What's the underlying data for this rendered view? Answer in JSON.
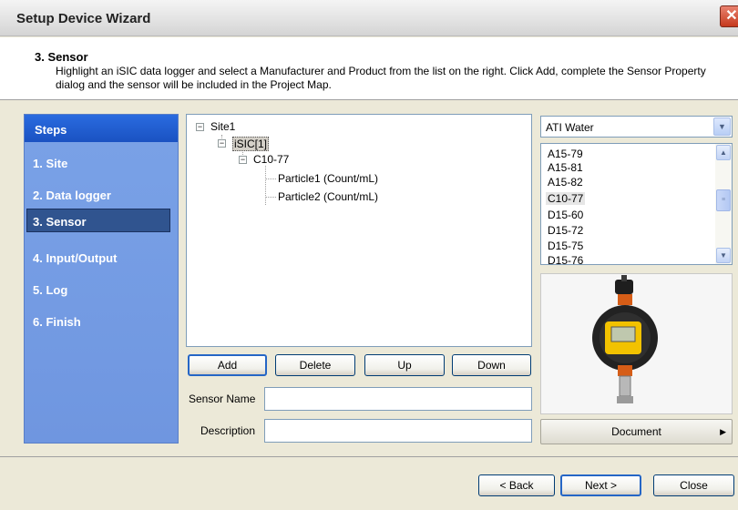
{
  "window": {
    "title": "Setup Device Wizard",
    "close_glyph": "✕"
  },
  "header": {
    "step_title": "3. Sensor",
    "description": "Highlight an iSIC data logger and select a Manufacturer and Product from the list on the right. Click Add, complete the Sensor Property dialog and the sensor will be included in the Project Map."
  },
  "steps": {
    "heading": "Steps",
    "items": [
      "1. Site",
      "2. Data logger",
      "3. Sensor",
      "4. Input/Output",
      "5. Log",
      "6. Finish"
    ],
    "active_index": 2
  },
  "tree": {
    "site": "Site1",
    "logger": "iSIC[1]",
    "sensor": "C10-77",
    "outputs": [
      "Particle1 (Count/mL)",
      "Particle2 (Count/mL)"
    ],
    "collapse_glyph": "−"
  },
  "buttons": {
    "add": "Add",
    "delete": "Delete",
    "up": "Up",
    "down": "Down"
  },
  "fields": {
    "sensor_name_label": "Sensor Name",
    "sensor_name_value": "",
    "description_label": "Description",
    "description_value": ""
  },
  "manufacturer": {
    "selected": "ATI Water"
  },
  "products": {
    "items": [
      "A15-79",
      "A15-81",
      "A15-82",
      "C10-77",
      "D15-60",
      "D15-72",
      "D15-75",
      "D15-76"
    ],
    "selected_index": 3
  },
  "document_button": "Document",
  "footer": {
    "back": "< Back",
    "next": "Next >",
    "close": "Close"
  },
  "colors": {
    "steps_bg": "#7aa2e7",
    "steps_header": "#2a6bdf",
    "active_step": "#30548f",
    "device_yellow": "#f2c200",
    "device_orange": "#e0621a"
  }
}
